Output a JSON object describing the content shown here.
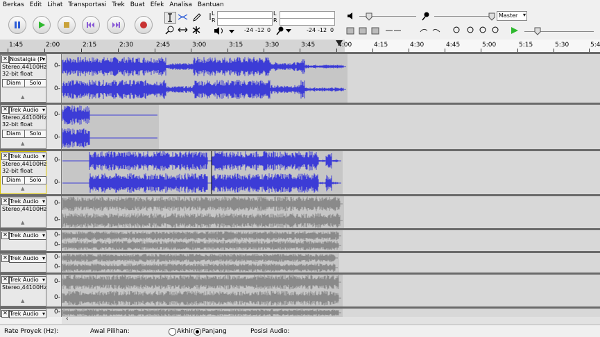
{
  "menu": [
    "Berkas",
    "Edit",
    "Lihat",
    "Transportasi",
    "Trek",
    "Buat",
    "Efek",
    "Analisa",
    "Bantuan"
  ],
  "meters": {
    "rec_scale": [
      "-24",
      "-12",
      "0"
    ],
    "play_scale": [
      "-24",
      "-12",
      "0"
    ],
    "lr": [
      "L",
      "R"
    ]
  },
  "mixer": {
    "device": "Master"
  },
  "ruler": {
    "labels": [
      "1:45",
      "2:00",
      "2:15",
      "2:30",
      "2:45",
      "3:00",
      "3:15",
      "3:30",
      "3:45",
      "4:00",
      "4:15",
      "4:30",
      "4:45",
      "5:00",
      "5:15",
      "5:30",
      "5:4"
    ]
  },
  "tracks": [
    {
      "name": "Nostalgia (P",
      "rate": "Stereo,44100Hz",
      "format": "32-bit float",
      "mute": "Diam",
      "solo": "Solo",
      "zero": "0-"
    },
    {
      "name": "Trek Audio",
      "rate": "Stereo,44100Hz",
      "format": "32-bit float",
      "mute": "Diam",
      "solo": "Solo",
      "zero": "0-"
    },
    {
      "name": "Trek Audio",
      "rate": "Stereo,44100Hz",
      "format": "32-bit float",
      "mute": "Diam",
      "solo": "Solo",
      "zero": "0-"
    },
    {
      "name": "Trek Audio",
      "rate": "Stereo,44100Hz",
      "zero": "0-"
    },
    {
      "name": "Trek Audio",
      "zero": "0-"
    },
    {
      "name": "Trek Audio",
      "zero": "0-"
    },
    {
      "name": "Trek Audio",
      "rate": "Stereo,44100Hz",
      "zero": "0-"
    },
    {
      "name": "Trek Audio",
      "zero": "0-"
    }
  ],
  "status": {
    "project_rate": "Rate Proyek (Hz):",
    "selection_start": "Awal Pilihan:",
    "end_option": "Akhir",
    "length_option": "Panjang",
    "audio_position": "Posisi Audio:"
  },
  "colors": {
    "wave_active": "#3c3cd6",
    "wave_gray": "#8a8a8a",
    "play_green": "#2eb82e",
    "record_red": "#c83232"
  }
}
